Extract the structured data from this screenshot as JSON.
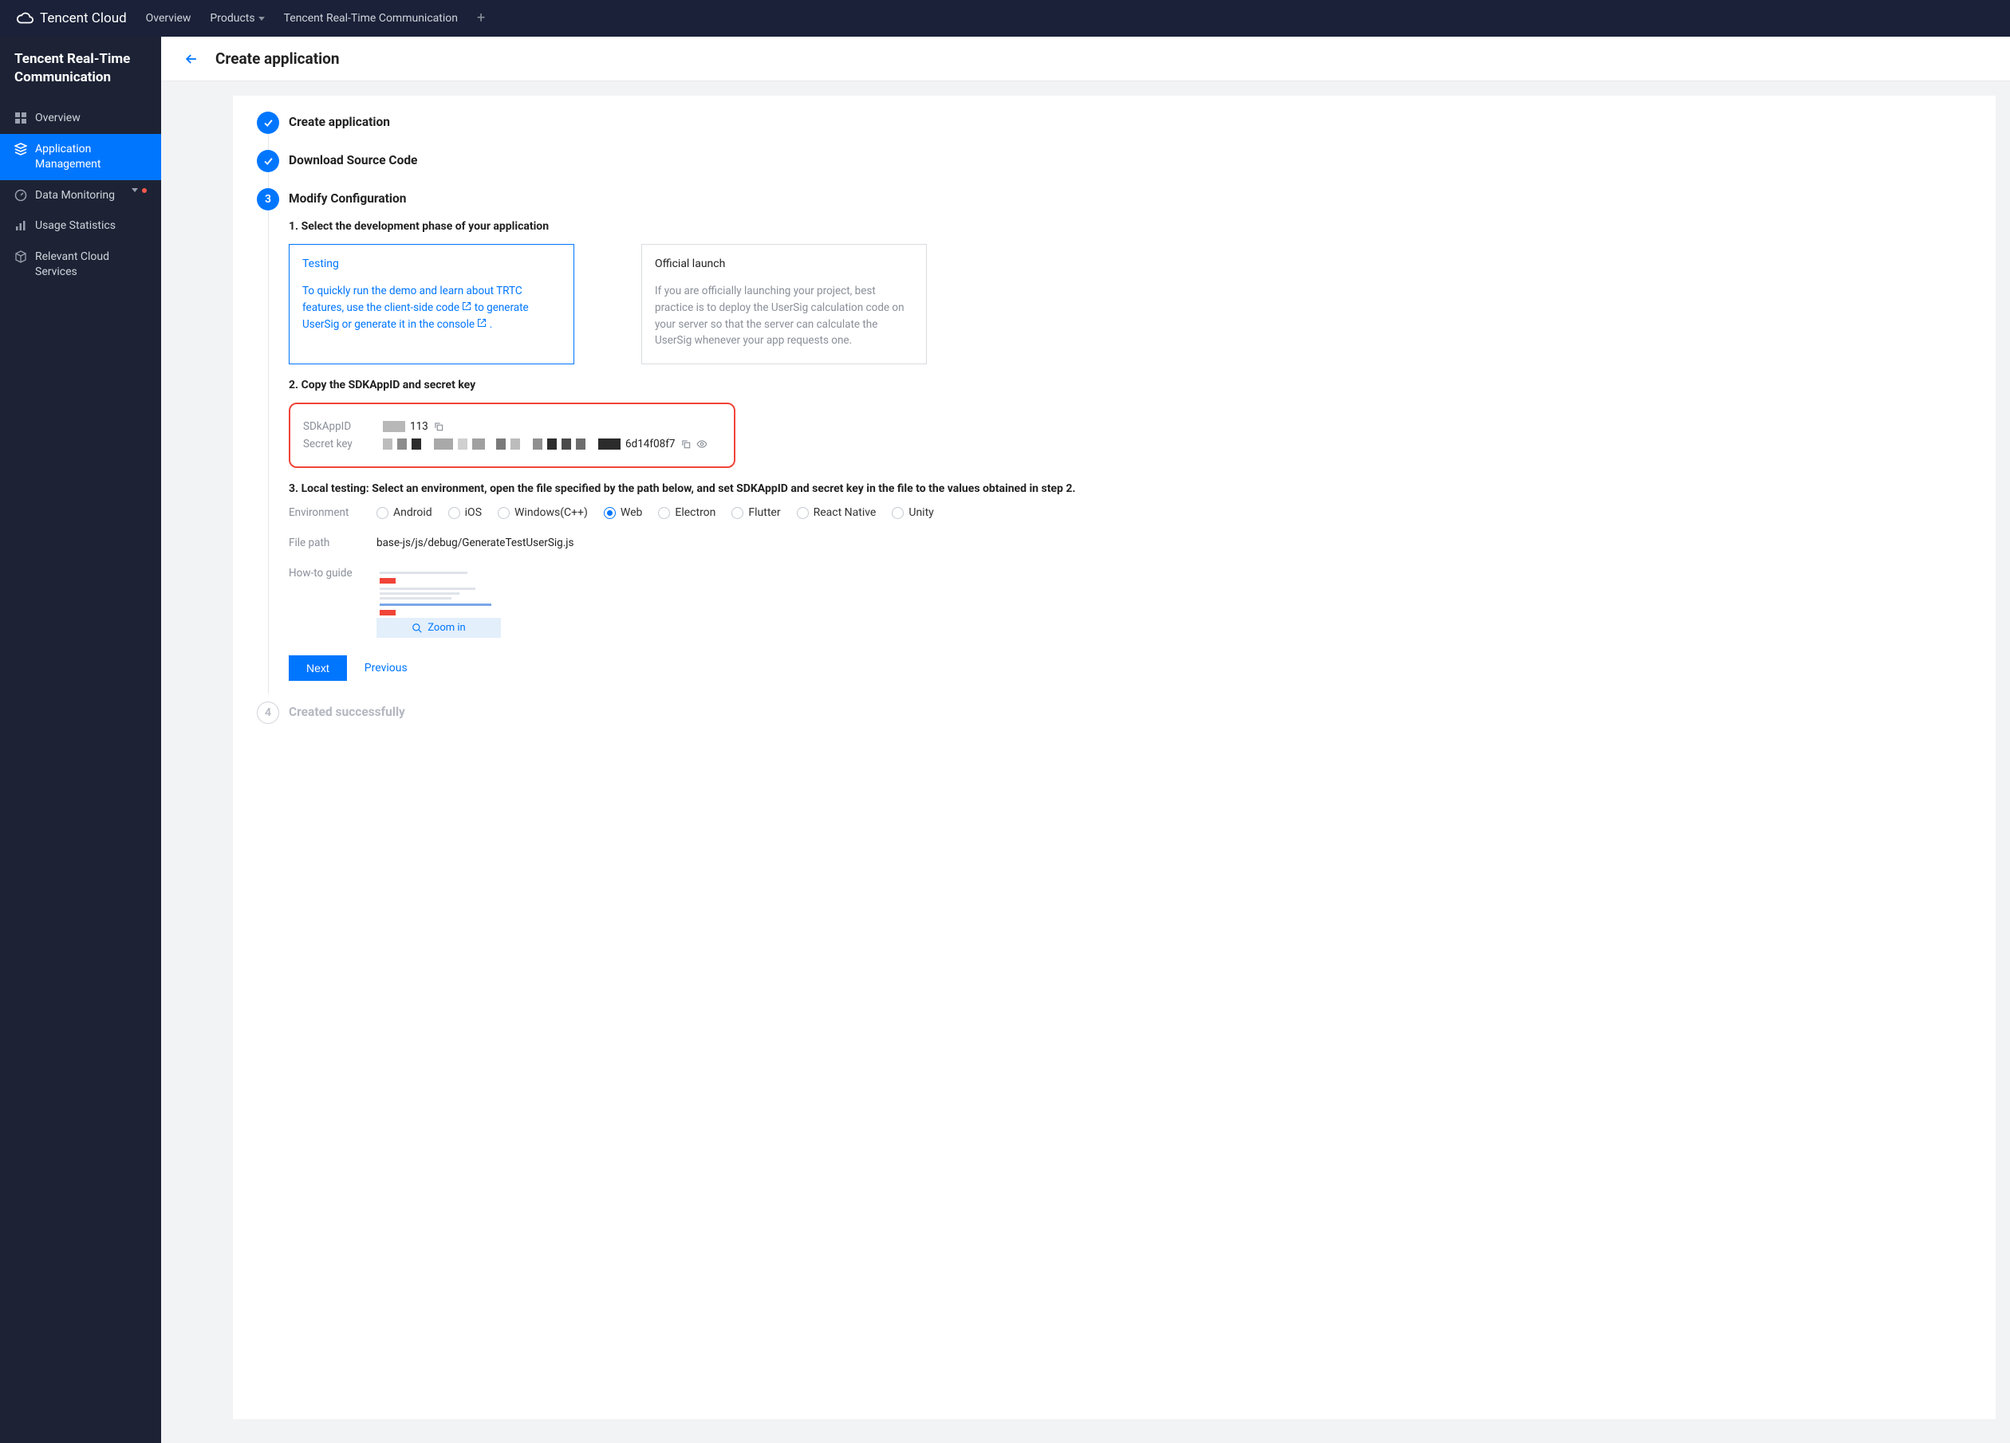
{
  "topnav": {
    "brand": "Tencent Cloud",
    "items": [
      "Overview",
      "Products",
      "Tencent Real-Time Communication"
    ]
  },
  "sidebar": {
    "title": "Tencent Real-Time Communication",
    "items": [
      {
        "label": "Overview",
        "icon": "grid-icon"
      },
      {
        "label": "Application Management",
        "icon": "layers-icon",
        "active": true
      },
      {
        "label": "Data Monitoring",
        "icon": "gauge-icon",
        "expandable": true,
        "alert": true
      },
      {
        "label": "Usage Statistics",
        "icon": "bars-icon"
      },
      {
        "label": "Relevant Cloud Services",
        "icon": "cube-icon"
      }
    ]
  },
  "header": {
    "title": "Create application"
  },
  "steps": {
    "s1": "Create application",
    "s2": "Download Source Code",
    "s3": "Modify Configuration",
    "s4": "Created successfully",
    "sub1": "1. Select the development phase of your application",
    "sub2": "2. Copy the SDKAppID and secret key",
    "sub3": "3. Local testing: Select an environment, open the file specified by the path below, and set SDKAppID and secret key in the file to the values obtained in step 2."
  },
  "phase": {
    "testing": {
      "title": "Testing",
      "desc_a": "To quickly run the demo and learn about TRTC features, use the client-side code",
      "desc_b": "to generate UserSig or generate it in the console",
      "desc_c": "."
    },
    "official": {
      "title": "Official launch",
      "desc": "If you are officially launching your project, best practice is to deploy the UserSig calculation code on your server so that the server can calculate the UserSig whenever your app requests one."
    }
  },
  "credentials": {
    "appid_label": "SDkAppID",
    "appid_suffix": "113",
    "secret_label": "Secret key",
    "secret_suffix": "6d14f08f7"
  },
  "env": {
    "label": "Environment",
    "options": [
      "Android",
      "iOS",
      "Windows(C++)",
      "Web",
      "Electron",
      "Flutter",
      "React Native",
      "Unity"
    ],
    "selected": "Web"
  },
  "file": {
    "label": "File path",
    "value": "base-js/js/debug/GenerateTestUserSig.js"
  },
  "guide": {
    "label": "How-to guide",
    "zoom": "Zoom in"
  },
  "actions": {
    "next": "Next",
    "prev": "Previous"
  }
}
